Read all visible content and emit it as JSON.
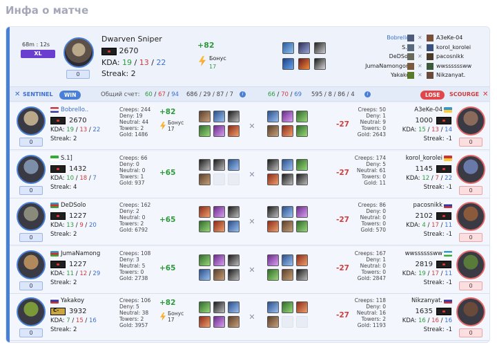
{
  "page_title": "Инфа о матче",
  "header": {
    "duration": "68m : 12s",
    "mode": "XL",
    "hero_name": "Dwarven Sniper",
    "mmr": "2670",
    "kda_label": "KDA:",
    "kills": "19",
    "deaths": "13",
    "assists": "22",
    "streak": "Streak: 2",
    "level": "0",
    "delta": "+82",
    "bonus_label": "Бонус",
    "bonus_value": "17",
    "mini_left": [
      "Bobrello..",
      "S.1]",
      "DeDSolo",
      "JumaNamongon..",
      "Yakakoy"
    ],
    "mini_right": [
      "A3eKe-04",
      "korol_korolei",
      "pacosnikk",
      "wwssssssww",
      "Nikzanyat."
    ]
  },
  "teams": {
    "sentinel_label": "SENTINEL",
    "win_label": "WIN",
    "score_label": "Общий счет:",
    "score_k": "60",
    "score_d": "67",
    "score_a": "94",
    "farm_left": "686 / 29 / 87 / 7",
    "score2_k": "66",
    "score2_d": "70",
    "score2_a": "69",
    "farm_right": "595 / 8 / 86 / 4",
    "lose_label": "LOSE",
    "scourge_label": "SCOURGE"
  },
  "rows": [
    {
      "l_name": "Bobrello..",
      "l_mmr": "2670",
      "l_k": "19",
      "l_d": "13",
      "l_a": "22",
      "l_streak": "Streak: 2",
      "l_level": "0",
      "l_creeps": "Creeps: 244",
      "l_deny": "Deny: 19",
      "l_neutral": "Neutral: 44",
      "l_towers": "Towers: 2",
      "l_gold": "Gold: 1486",
      "l_delta": "+82",
      "l_bonus": "Бонус",
      "l_bonus_val": "17",
      "r_name": "A3eKe-04",
      "r_mmr": "1000",
      "r_k": "15",
      "r_d": "13",
      "r_a": "14",
      "r_streak": "Streak: -1",
      "r_level": "0",
      "r_creeps": "Creeps: 50",
      "r_deny": "Deny: 1",
      "r_neutral": "Neutral: 9",
      "r_towers": "Towers: 0",
      "r_gold": "Gold: 2643",
      "r_delta": "-27"
    },
    {
      "l_name": "S.1]",
      "l_mmr": "1432",
      "l_k": "10",
      "l_d": "18",
      "l_a": "7",
      "l_streak": "Streak: 4",
      "l_level": "0",
      "l_creeps": "Creeps: 66",
      "l_deny": "Deny: 0",
      "l_neutral": "Neutral: 0",
      "l_towers": "Towers: 1",
      "l_gold": "Gold: 937",
      "l_delta": "+65",
      "r_name": "korol_korolei",
      "r_mmr": "1145",
      "r_k": "12",
      "r_d": "7",
      "r_a": "22",
      "r_streak": "Streak: -1",
      "r_level": "0",
      "r_creeps": "Creeps: 174",
      "r_deny": "Deny: 5",
      "r_neutral": "Neutral: 61",
      "r_towers": "Towers: 0",
      "r_gold": "Gold: 11",
      "r_delta": "-27"
    },
    {
      "l_name": "DeDSolo",
      "l_mmr": "1227",
      "l_k": "13",
      "l_d": "9",
      "l_a": "20",
      "l_streak": "Streak: 2",
      "l_level": "0",
      "l_creeps": "Creeps: 162",
      "l_deny": "Deny: 2",
      "l_neutral": "Neutral: 0",
      "l_towers": "Towers: 2",
      "l_gold": "Gold: 6792",
      "l_delta": "+65",
      "r_name": "pacosnikk",
      "r_mmr": "2102",
      "r_k": "4",
      "r_d": "17",
      "r_a": "11",
      "r_streak": "Streak: -1",
      "r_level": "0",
      "r_creeps": "Creeps: 86",
      "r_deny": "Deny: 0",
      "r_neutral": "Neutral: 0",
      "r_towers": "Towers: 0",
      "r_gold": "Gold: 570",
      "r_delta": "-27"
    },
    {
      "l_name": "JumaNamong",
      "l_mmr": "1227",
      "l_k": "11",
      "l_d": "12",
      "l_a": "29",
      "l_streak": "Streak: 2",
      "l_level": "0",
      "l_creeps": "Creeps: 108",
      "l_deny": "Deny: 3",
      "l_neutral": "Neutral: 5",
      "l_towers": "Towers: 0",
      "l_gold": "Gold: 2738",
      "l_delta": "+65",
      "r_name": "wwssssssww",
      "r_mmr": "2819",
      "r_k": "19",
      "r_d": "17",
      "r_a": "11",
      "r_streak": "Streak: -1",
      "r_level": "0",
      "r_creeps": "Creeps: 167",
      "r_deny": "Deny: 1",
      "r_neutral": "Neutral: 0",
      "r_towers": "Towers: 0",
      "r_gold": "Gold: 2847",
      "r_delta": "-27"
    },
    {
      "l_name": "Yakakoy",
      "l_mmr": "3932",
      "l_k": "7",
      "l_d": "15",
      "l_a": "16",
      "l_streak": "Streak: 2",
      "l_level": "0",
      "l_creeps": "Creeps: 106",
      "l_deny": "Deny: 5",
      "l_neutral": "Neutral: 38",
      "l_towers": "Towers: 2",
      "l_gold": "Gold: 3957",
      "l_delta": "+82",
      "l_bonus": "Бонус",
      "l_bonus_val": "17",
      "r_name": "Nikzanyat.",
      "r_mmr": "1635",
      "r_k": "16",
      "r_d": "16",
      "r_a": "16",
      "r_streak": "Streak: -1",
      "r_level": "0",
      "r_creeps": "Creeps: 118",
      "r_deny": "Deny: 0",
      "r_neutral": "Neutral: 16",
      "r_towers": "Towers: 2",
      "r_gold": "Gold: 1193",
      "r_delta": "-27"
    }
  ],
  "colors": {
    "sentinel": "#4a7fd6",
    "scourge": "#e0474b",
    "kills": "#2c9a3a",
    "deaths": "#d33b3b",
    "assists": "#3b6fd3"
  },
  "icons": [
    "crossed-swords-icon",
    "bolt-icon",
    "info-icon"
  ]
}
